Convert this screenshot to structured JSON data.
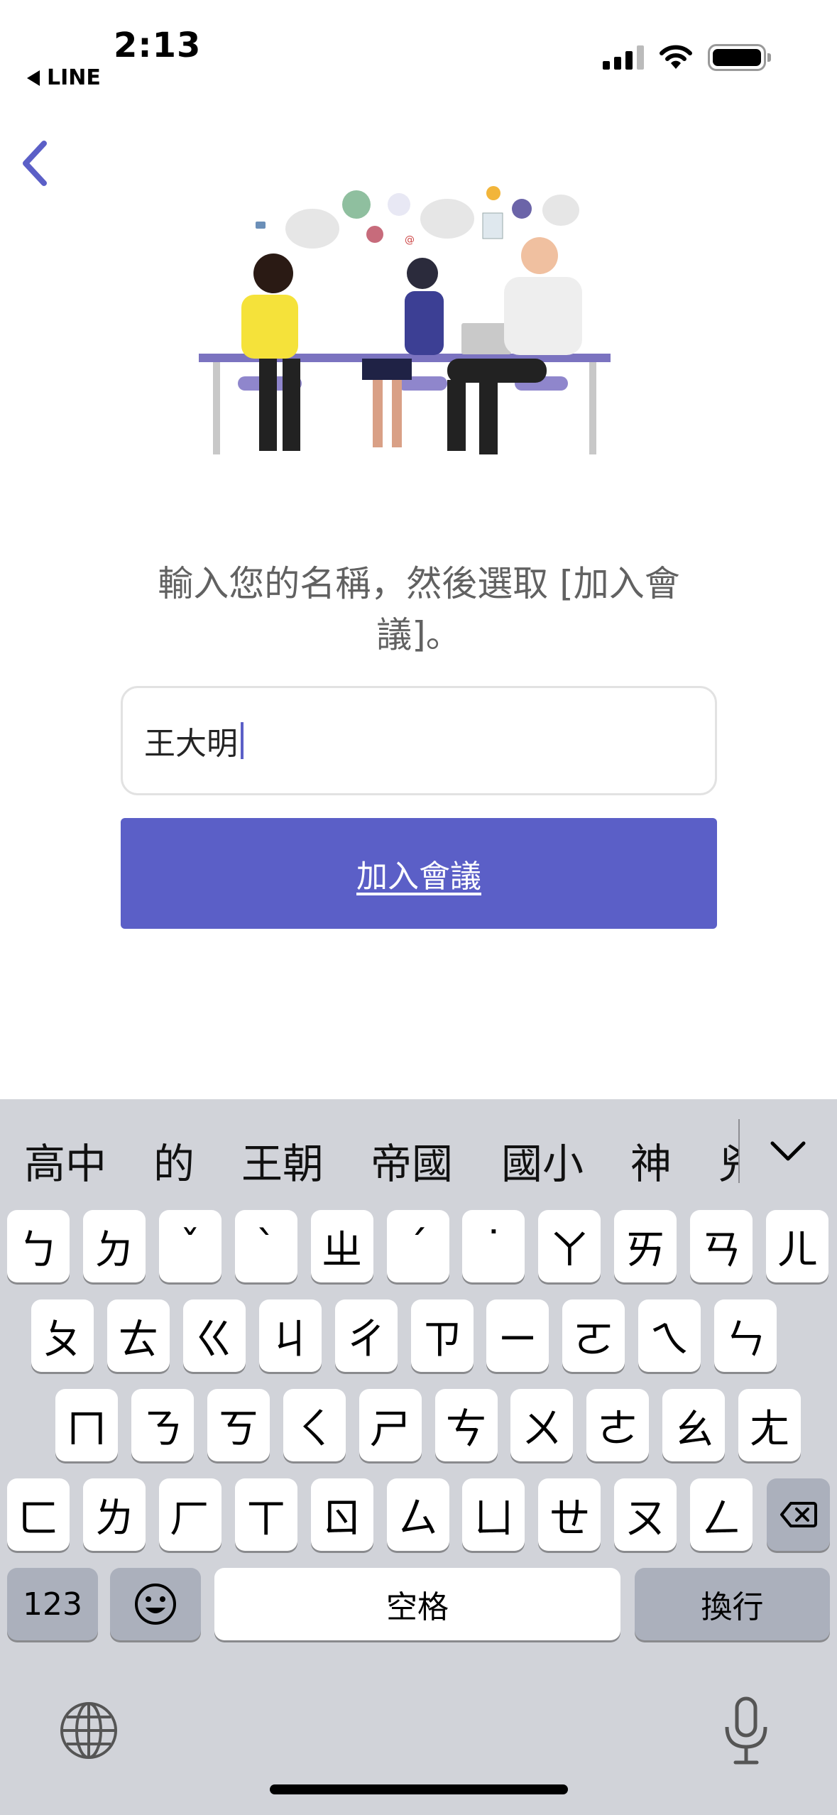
{
  "status_bar": {
    "time": "2:13",
    "back_app": "LINE"
  },
  "instruction": "輸入您的名稱，然後選取 [加入會議]。",
  "name_input": {
    "value": "王大明"
  },
  "join_button": {
    "label": "加入會議"
  },
  "keyboard": {
    "candidates": [
      "高中",
      "的",
      "王朝",
      "帝國",
      "國小",
      "神",
      "兇"
    ],
    "row1": [
      "ㄅ",
      "ㄉ",
      "ˇ",
      "ˋ",
      "ㄓ",
      "ˊ",
      "˙",
      "ㄚ",
      "ㄞ",
      "ㄢ",
      "ㄦ"
    ],
    "row2": [
      "ㄆ",
      "ㄊ",
      "ㄍ",
      "ㄐ",
      "ㄔ",
      "ㄗ",
      "ㄧ",
      "ㄛ",
      "ㄟ",
      "ㄣ"
    ],
    "row3": [
      "ㄇ",
      "ㄋ",
      "ㄎ",
      "ㄑ",
      "ㄕ",
      "ㄘ",
      "ㄨ",
      "ㄜ",
      "ㄠ",
      "ㄤ"
    ],
    "row4": [
      "ㄈ",
      "ㄌ",
      "ㄏ",
      "ㄒ",
      "ㄖ",
      "ㄙ",
      "ㄩ",
      "ㄝ",
      "ㄡ",
      "ㄥ"
    ],
    "numbers_label": "123",
    "space_label": "空格",
    "return_label": "換行"
  },
  "colors": {
    "accent": "#5b5fc7",
    "keyboard_bg": "#d1d3d9",
    "instruction_text": "#616161"
  }
}
